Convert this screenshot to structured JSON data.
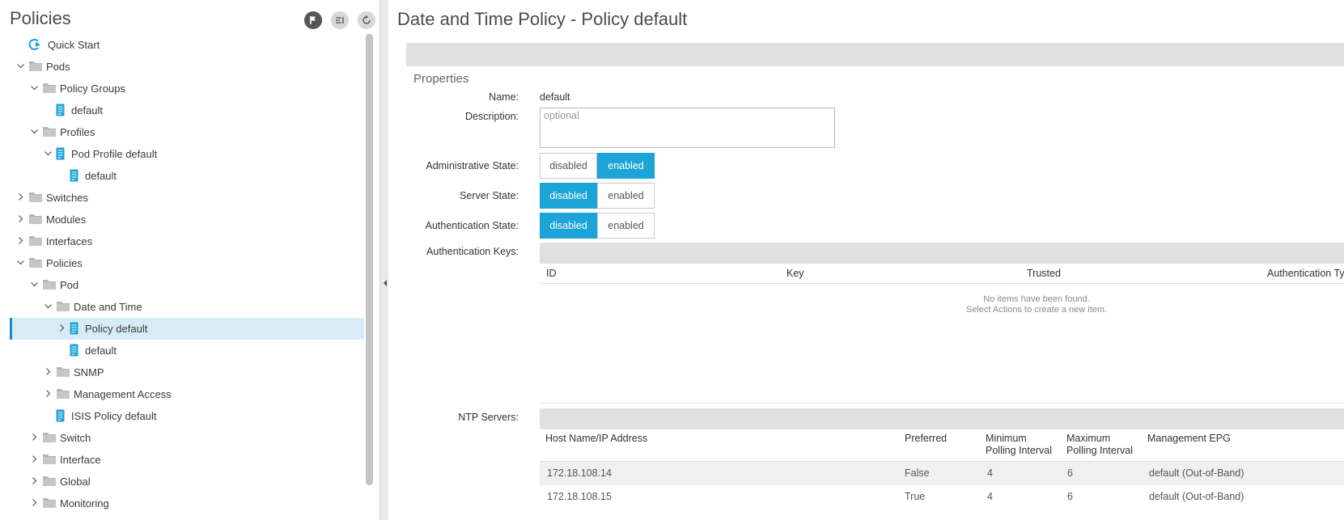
{
  "left_panel": {
    "title": "Policies",
    "tree": [
      {
        "label": "Quick Start",
        "icon": "quick-start-icon",
        "arrow": "none"
      },
      {
        "label": "Pods",
        "icon": "folder-icon",
        "arrow": "down"
      },
      {
        "label": "Policy Groups",
        "icon": "folder-icon",
        "arrow": "down"
      },
      {
        "label": "default",
        "icon": "document-icon",
        "arrow": "none"
      },
      {
        "label": "Profiles",
        "icon": "folder-icon",
        "arrow": "down"
      },
      {
        "label": "Pod Profile default",
        "icon": "document-icon",
        "arrow": "down"
      },
      {
        "label": "default",
        "icon": "document-icon",
        "arrow": "none"
      },
      {
        "label": "Switches",
        "icon": "folder-icon",
        "arrow": "right"
      },
      {
        "label": "Modules",
        "icon": "folder-icon",
        "arrow": "right"
      },
      {
        "label": "Interfaces",
        "icon": "folder-icon",
        "arrow": "right"
      },
      {
        "label": "Policies",
        "icon": "folder-icon",
        "arrow": "down"
      },
      {
        "label": "Pod",
        "icon": "folder-icon",
        "arrow": "down"
      },
      {
        "label": "Date and Time",
        "icon": "folder-icon",
        "arrow": "down"
      },
      {
        "label": "Policy default",
        "icon": "document-icon",
        "arrow": "right",
        "selected": true
      },
      {
        "label": "default",
        "icon": "document-icon",
        "arrow": "none"
      },
      {
        "label": "SNMP",
        "icon": "folder-icon",
        "arrow": "right"
      },
      {
        "label": "Management Access",
        "icon": "folder-icon",
        "arrow": "right"
      },
      {
        "label": "ISIS Policy default",
        "icon": "document-icon",
        "arrow": "none"
      },
      {
        "label": "Switch",
        "icon": "folder-icon",
        "arrow": "right"
      },
      {
        "label": "Interface",
        "icon": "folder-icon",
        "arrow": "right"
      },
      {
        "label": "Global",
        "icon": "folder-icon",
        "arrow": "right"
      },
      {
        "label": "Monitoring",
        "icon": "folder-icon",
        "arrow": "right"
      },
      {
        "label": "",
        "icon": "folder-icon",
        "arrow": "none"
      }
    ]
  },
  "main": {
    "title": "Date and Time Policy - Policy default",
    "properties_heading": "Properties",
    "name_label": "Name:",
    "name_value": "default",
    "description_label": "Description:",
    "description_placeholder": "optional",
    "admin_state": {
      "label": "Administrative State:",
      "options": [
        "disabled",
        "enabled"
      ],
      "selected": "enabled"
    },
    "server_state": {
      "label": "Server State:",
      "options": [
        "disabled",
        "enabled"
      ],
      "selected": "disabled"
    },
    "auth_state": {
      "label": "Authentication State:",
      "options": [
        "disabled",
        "enabled"
      ],
      "selected": "disabled"
    },
    "auth_keys": {
      "label": "Authentication Keys:",
      "columns": [
        "ID",
        "Key",
        "Trusted",
        "Authentication Ty"
      ],
      "empty_line1": "No items have been found.",
      "empty_line2": "Select Actions to create a new item."
    },
    "ntp_servers": {
      "label": "NTP Servers:",
      "columns": [
        "Host Name/IP Address",
        "Preferred",
        "Minimum\nPolling Interval",
        "Maximum\nPolling Interval",
        "Management EPG"
      ],
      "rows": [
        [
          "172.18.108.14",
          "False",
          "4",
          "6",
          "default (Out-of-Band)"
        ],
        [
          "172.18.108.15",
          "True",
          "4",
          "6",
          "default (Out-of-Band)"
        ]
      ]
    }
  },
  "colors": {
    "accent": "#1ca3d8",
    "selected_row": "#d8ecf6",
    "band": "#e0e0e0"
  }
}
